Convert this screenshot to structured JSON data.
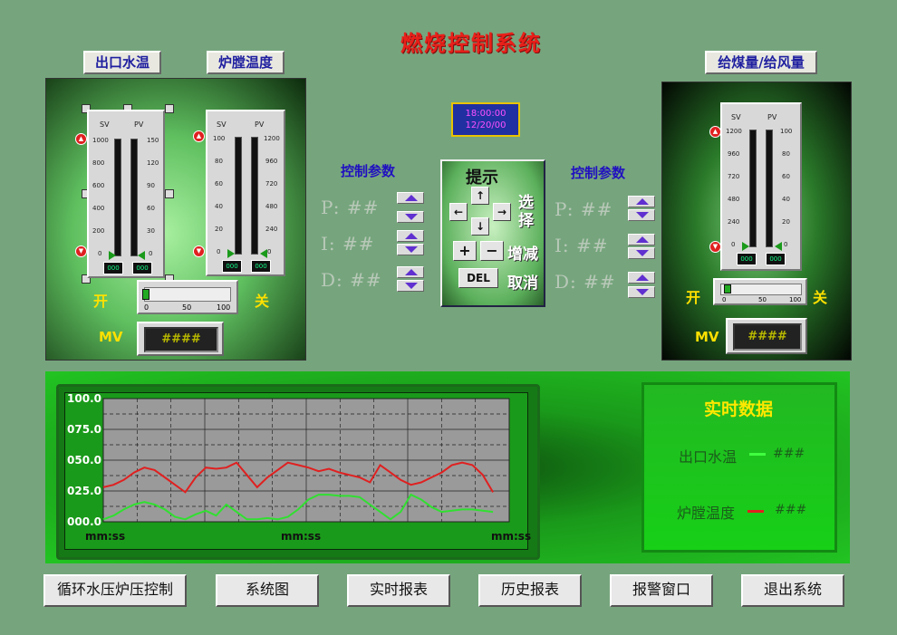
{
  "title": "燃烧控制系统",
  "left": {
    "label1": "出口水温",
    "label2": "炉膛温度",
    "gauge1": {
      "sv": "SV",
      "pv": "PV",
      "sv_ticks": [
        "1000",
        "800",
        "600",
        "400",
        "200",
        "0"
      ],
      "pv_ticks": [
        "150",
        "120",
        "90",
        "60",
        "30",
        "0"
      ],
      "led1": "000",
      "led2": "000"
    },
    "gauge2": {
      "sv": "SV",
      "pv": "PV",
      "sv_ticks": [
        "100",
        "80",
        "60",
        "40",
        "20",
        "0"
      ],
      "pv_ticks": [
        "1200",
        "960",
        "720",
        "480",
        "240",
        "0"
      ],
      "led1": "000",
      "led2": "000"
    },
    "slider": {
      "min": "0",
      "mid": "50",
      "max": "100"
    },
    "open": "开",
    "close": "关",
    "mv_label": "MV",
    "mv_value": "####"
  },
  "clock": {
    "time": "18:00:00",
    "date": "12/20/00"
  },
  "left_params": {
    "title": "控制参数",
    "p": "P: ##",
    "i": "I: ##",
    "d": "D: ##"
  },
  "right_params": {
    "title": "控制参数",
    "p": "P: ##",
    "i": "I: ##",
    "d": "D: ##"
  },
  "hint": {
    "title": "提示",
    "select": "选择",
    "adjust": "增减",
    "cancel": "取消",
    "plus": "+",
    "minus": "−",
    "del": "DEL",
    "up": "↑",
    "down": "↓",
    "left": "←",
    "right": "→"
  },
  "right": {
    "label": "给煤量/给风量",
    "gauge": {
      "sv": "SV",
      "pv": "PV",
      "sv_ticks": [
        "1200",
        "960",
        "720",
        "480",
        "240",
        "0"
      ],
      "pv_ticks": [
        "100",
        "80",
        "60",
        "40",
        "20",
        "0"
      ],
      "led1": "000",
      "led2": "000"
    },
    "slider": {
      "min": "0",
      "mid": "50",
      "max": "100"
    },
    "open": "开",
    "close": "关",
    "mv_label": "MV",
    "mv_value": "####"
  },
  "chart_data": {
    "type": "line",
    "y_ticks": [
      "100.0",
      "075.0",
      "050.0",
      "025.0",
      "000.0"
    ],
    "x_labels": [
      "mm:ss",
      "mm:ss",
      "mm:ss"
    ],
    "ylim": [
      0,
      100
    ],
    "grid": true,
    "series": [
      {
        "color": "#e02020",
        "values": [
          28,
          30,
          34,
          40,
          44,
          42,
          36,
          30,
          24,
          36,
          44,
          43,
          44,
          48,
          38,
          28,
          36,
          42,
          48,
          46,
          44,
          41,
          43,
          40,
          38,
          36,
          32,
          46,
          40,
          34,
          30,
          32,
          36,
          40,
          46,
          48,
          46,
          38,
          24
        ]
      },
      {
        "color": "#30e030",
        "values": [
          2,
          5,
          10,
          14,
          16,
          14,
          10,
          4,
          2,
          6,
          9,
          5,
          14,
          8,
          2,
          2,
          3,
          2,
          4,
          10,
          18,
          22,
          22,
          21,
          21,
          20,
          14,
          8,
          2,
          8,
          22,
          18,
          12,
          8,
          9,
          10,
          10,
          9,
          8
        ]
      }
    ]
  },
  "realtime": {
    "title": "实时数据",
    "items": [
      {
        "name": "出口水温",
        "value": "###",
        "color": "#40ff40"
      },
      {
        "name": "炉膛温度",
        "value": "###",
        "color": "#e02020"
      }
    ]
  },
  "nav": [
    "循环水压炉压控制",
    "系统图",
    "实时报表",
    "历史报表",
    "报警窗口",
    "退出系统"
  ]
}
